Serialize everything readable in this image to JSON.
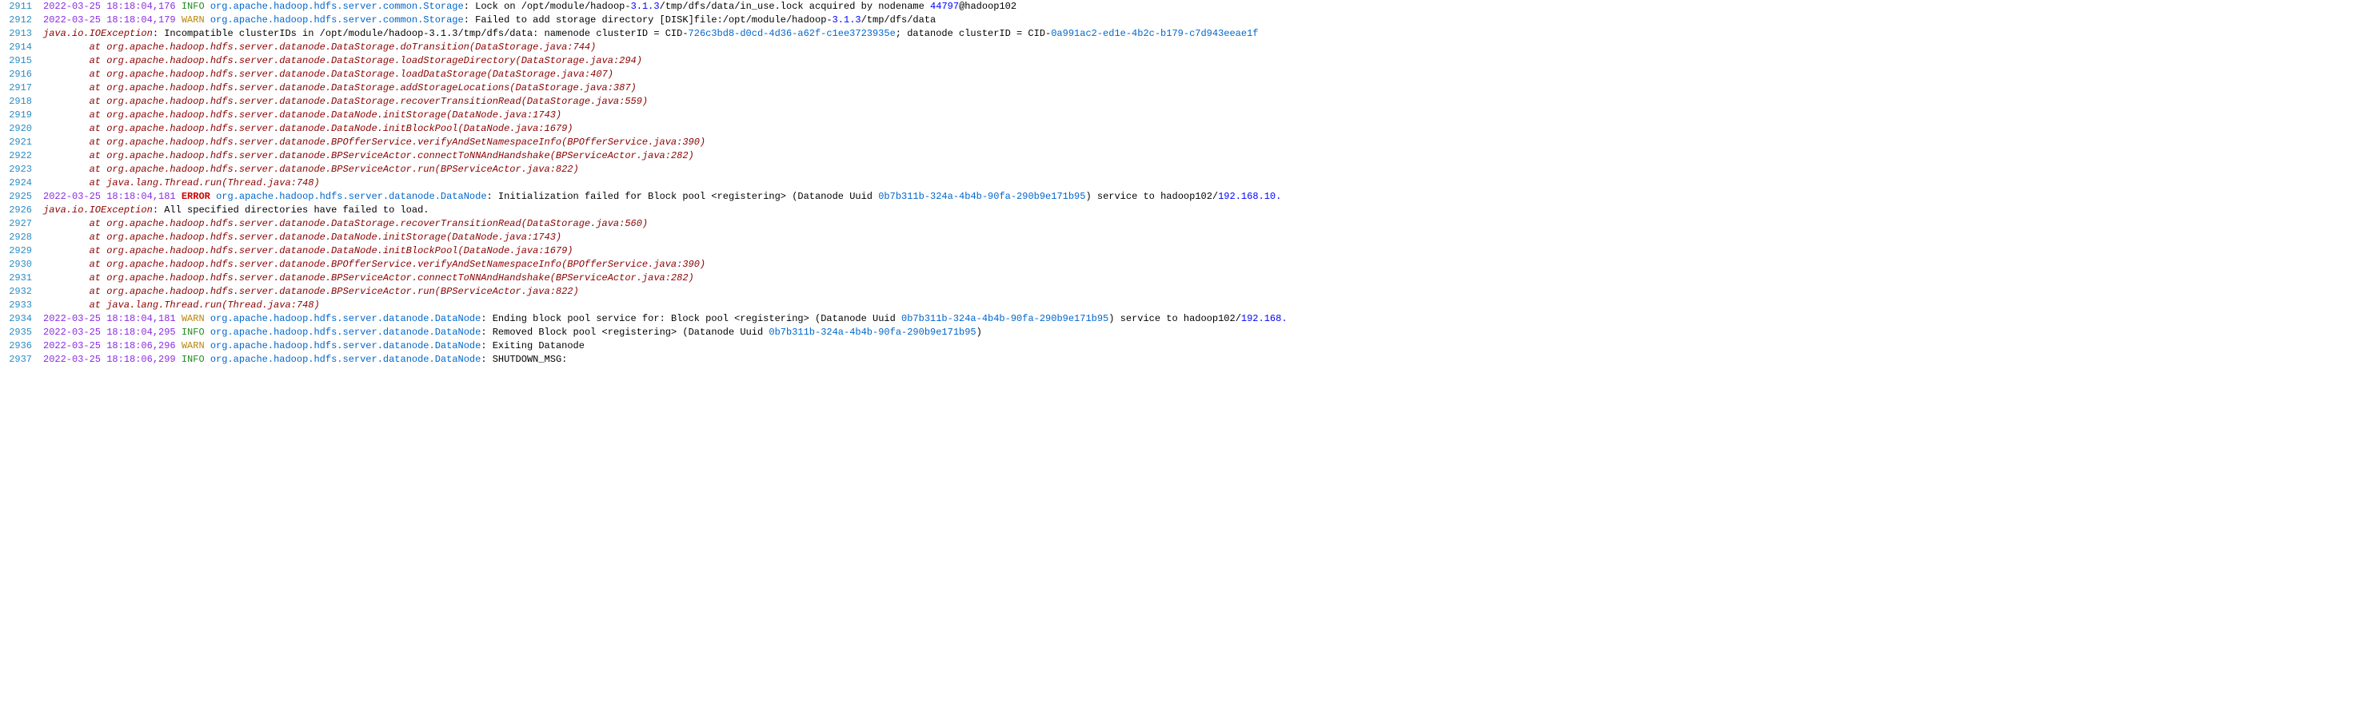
{
  "lines": [
    {
      "no": "2911",
      "type": "log",
      "ts": "2022-03-25 18:18:04,176",
      "level": "INFO",
      "src": "org.apache.hadoop.hdfs.server.common.Storage",
      "msg_pre": ": Lock on /opt/module/hadoop-",
      "ver": "3.1.3",
      "msg_mid": "/tmp/dfs/data/in_use.lock acquired by nodename ",
      "nodeid": "44797",
      "msg_post": "@hadoop102"
    },
    {
      "no": "2912",
      "type": "log",
      "ts": "2022-03-25 18:18:04,179",
      "level": "WARN",
      "src": "org.apache.hadoop.hdfs.server.common.Storage",
      "msg_pre": ": Failed to add storage directory [DISK]file:/opt/module/hadoop-",
      "ver": "3.1.3",
      "msg_post": "/tmp/dfs/data"
    },
    {
      "no": "2913",
      "type": "exception",
      "exname": "java.io.IOException",
      "msg_pre": ": Incompatible clusterIDs in /opt/module/hadoop-3.1.3/tmp/dfs/data: namenode clusterID = CID-",
      "id1": "726c3bd8-d0cd-4d36-a62f-c1ee3723935e",
      "msg_mid": "; datanode clusterID = CID-",
      "id2": "0a991ac2-ed1e-4b2c-b179-c7d943eeae1f"
    },
    {
      "no": "2914",
      "type": "stack",
      "text": "        at org.apache.hadoop.hdfs.server.datanode.DataStorage.doTransition(DataStorage.java:744)"
    },
    {
      "no": "2915",
      "type": "stack",
      "text": "        at org.apache.hadoop.hdfs.server.datanode.DataStorage.loadStorageDirectory(DataStorage.java:294)"
    },
    {
      "no": "2916",
      "type": "stack",
      "text": "        at org.apache.hadoop.hdfs.server.datanode.DataStorage.loadDataStorage(DataStorage.java:407)"
    },
    {
      "no": "2917",
      "type": "stack",
      "text": "        at org.apache.hadoop.hdfs.server.datanode.DataStorage.addStorageLocations(DataStorage.java:387)"
    },
    {
      "no": "2918",
      "type": "stack",
      "text": "        at org.apache.hadoop.hdfs.server.datanode.DataStorage.recoverTransitionRead(DataStorage.java:559)"
    },
    {
      "no": "2919",
      "type": "stack",
      "text": "        at org.apache.hadoop.hdfs.server.datanode.DataNode.initStorage(DataNode.java:1743)"
    },
    {
      "no": "2920",
      "type": "stack",
      "text": "        at org.apache.hadoop.hdfs.server.datanode.DataNode.initBlockPool(DataNode.java:1679)"
    },
    {
      "no": "2921",
      "type": "stack",
      "text": "        at org.apache.hadoop.hdfs.server.datanode.BPOfferService.verifyAndSetNamespaceInfo(BPOfferService.java:390)"
    },
    {
      "no": "2922",
      "type": "stack",
      "text": "        at org.apache.hadoop.hdfs.server.datanode.BPServiceActor.connectToNNAndHandshake(BPServiceActor.java:282)"
    },
    {
      "no": "2923",
      "type": "stack",
      "text": "        at org.apache.hadoop.hdfs.server.datanode.BPServiceActor.run(BPServiceActor.java:822)"
    },
    {
      "no": "2924",
      "type": "stack",
      "text": "        at java.lang.Thread.run(Thread.java:748)"
    },
    {
      "no": "2925",
      "type": "log",
      "ts": "2022-03-25 18:18:04,181",
      "level": "ERROR",
      "src": "org.apache.hadoop.hdfs.server.datanode.DataNode",
      "msg_pre": ": Initialization failed for Block pool <registering> (Datanode Uuid ",
      "uuid": "0b7b311b-324a-4b4b-90fa-290b9e171b95",
      "msg_mid": ") service to hadoop102/",
      "ip": "192.168.10."
    },
    {
      "no": "2926",
      "type": "exception",
      "exname": "java.io.IOException",
      "msg_pre": ": All specified directories have failed to load."
    },
    {
      "no": "2927",
      "type": "stack",
      "text": "        at org.apache.hadoop.hdfs.server.datanode.DataStorage.recoverTransitionRead(DataStorage.java:560)"
    },
    {
      "no": "2928",
      "type": "stack",
      "text": "        at org.apache.hadoop.hdfs.server.datanode.DataNode.initStorage(DataNode.java:1743)"
    },
    {
      "no": "2929",
      "type": "stack",
      "text": "        at org.apache.hadoop.hdfs.server.datanode.DataNode.initBlockPool(DataNode.java:1679)"
    },
    {
      "no": "2930",
      "type": "stack",
      "text": "        at org.apache.hadoop.hdfs.server.datanode.BPOfferService.verifyAndSetNamespaceInfo(BPOfferService.java:390)"
    },
    {
      "no": "2931",
      "type": "stack",
      "text": "        at org.apache.hadoop.hdfs.server.datanode.BPServiceActor.connectToNNAndHandshake(BPServiceActor.java:282)"
    },
    {
      "no": "2932",
      "type": "stack",
      "text": "        at org.apache.hadoop.hdfs.server.datanode.BPServiceActor.run(BPServiceActor.java:822)"
    },
    {
      "no": "2933",
      "type": "stack",
      "text": "        at java.lang.Thread.run(Thread.java:748)"
    },
    {
      "no": "2934",
      "type": "log",
      "ts": "2022-03-25 18:18:04,181",
      "level": "WARN",
      "src": "org.apache.hadoop.hdfs.server.datanode.DataNode",
      "msg_pre": ": Ending block pool service for: Block pool <registering> (Datanode Uuid ",
      "uuid": "0b7b311b-324a-4b4b-90fa-290b9e171b95",
      "msg_mid": ") service to hadoop102/",
      "ip": "192.168."
    },
    {
      "no": "2935",
      "type": "log",
      "ts": "2022-03-25 18:18:04,295",
      "level": "INFO",
      "src": "org.apache.hadoop.hdfs.server.datanode.DataNode",
      "msg_pre": ": Removed Block pool <registering> (Datanode Uuid ",
      "uuid": "0b7b311b-324a-4b4b-90fa-290b9e171b95",
      "msg_post": ")"
    },
    {
      "no": "2936",
      "type": "log",
      "ts": "2022-03-25 18:18:06,296",
      "level": "WARN",
      "src": "org.apache.hadoop.hdfs.server.datanode.DataNode",
      "msg_pre": ": Exiting Datanode"
    },
    {
      "no": "2937",
      "type": "log",
      "ts": "2022-03-25 18:18:06,299",
      "level": "INFO",
      "src": "org.apache.hadoop.hdfs.server.datanode.DataNode",
      "msg_pre": ": SHUTDOWN_MSG:"
    }
  ],
  "level_classes": {
    "INFO": "info",
    "WARN": "warn",
    "ERROR": "error"
  }
}
